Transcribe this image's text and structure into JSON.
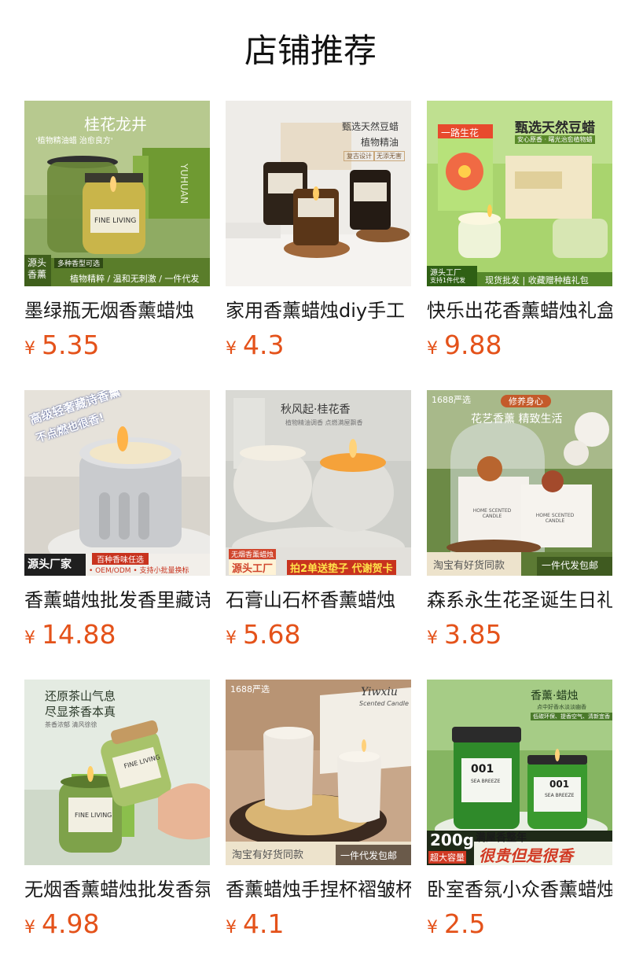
{
  "section_title": "店铺推荐",
  "currency_symbol": "¥",
  "products": [
    {
      "name": "墨绿瓶无烟香薰蜡烛",
      "price": "5.35",
      "overlay": {
        "headline": "桂花龙井",
        "sub": "'植物精油蜡 治愈良方'",
        "label": "FINE LIVING",
        "box_text": "YUHUAN",
        "badge": "源头香薰",
        "tag": "多种香型可选",
        "bar": "植物精粹 / 温和无刺激 / 一件代发"
      },
      "colors": {
        "bg": "#9bb56a",
        "jar": "#5f7f32"
      }
    },
    {
      "name": "家用香薰蜡烛diy手工",
      "price": "4.3",
      "overlay": {
        "headline": "甄选天然豆蜡",
        "sub": "植物精油",
        "tag1": "复古设计",
        "tag2": "无添无害"
      },
      "colors": {
        "bg": "#ece9e6",
        "jar": "#3b2a1e"
      }
    },
    {
      "name": "快乐出花香薰蜡烛礼盒",
      "price": "9.88",
      "overlay": {
        "headline": "甄选天然豆蜡",
        "sub": "安心原香 · 曙光治愈植物蜡",
        "box_text": "一路生花",
        "badge": "源头工厂",
        "badge_sub": "支持1件代发",
        "bar": "现货批发 | 收藏赠种植礼包"
      },
      "colors": {
        "bg": "#a7d36c",
        "jar": "#e6f2c9"
      }
    },
    {
      "name": "香薰蜡烛批发香里藏诗",
      "price": "14.88",
      "overlay": {
        "headline": "高级轻奢藏诗香薰",
        "sub": "不点燃也很香!",
        "badge": "源头厂家",
        "tag": "百种香味任选",
        "bar": "• OEM/ODM • 支持小批量换标"
      },
      "colors": {
        "bg": "#dcd8d2",
        "jar": "#c7c9cc"
      }
    },
    {
      "name": "石膏山石杯香薰蜡烛",
      "price": "5.68",
      "overlay": {
        "headline": "秋风起·桂花香",
        "sub": "植物精油调香 点燃满屋飘香",
        "tag": "无烟香薰蜡烛",
        "badge": "源头工厂",
        "bar": "拍2单送垫子 代谢贺卡"
      },
      "colors": {
        "bg": "#cfd0cb",
        "jar": "#e3e2dd"
      }
    },
    {
      "name": "森系永生花圣诞生日礼物",
      "price": "3.85",
      "overlay": {
        "corner": "1688严选",
        "ribbon": "修养身心",
        "headline": "花艺香薰 精致生活",
        "jar_label1": "HOME SCENTED CANDLE",
        "jar_label2": "HOME SCENTED CANDLE",
        "left": "淘宝有好货同款",
        "right": "一件代发包邮"
      },
      "colors": {
        "bg": "#5f7a3e",
        "jar": "#f4f1ec"
      }
    },
    {
      "name": "无烟香薰蜡烛批发香氛",
      "price": "4.98",
      "overlay": {
        "headline1": "还原茶山气息",
        "headline2": "尽显茶香本真",
        "sub": "茶香浓郁  清风徐徐",
        "label1": "FINE LIVING",
        "label2": "FINE LIVING"
      },
      "colors": {
        "bg": "#dfe6dc",
        "jar": "#7ea24a"
      }
    },
    {
      "name": "香薰蜡烛手捏杯褶皱杯",
      "price": "4.1",
      "overlay": {
        "corner": "1688严选",
        "brand": "Yiwxiu",
        "brand_sub": "Scented Candle",
        "left": "淘宝有好货同款",
        "right": "一件代发包邮"
      },
      "colors": {
        "bg": "#c9a88a",
        "jar": "#eeeae4"
      }
    },
    {
      "name": "卧室香氛小众香薰蜡烛",
      "price": "2.5",
      "overlay": {
        "headline": "香薰·蜡烛",
        "sub": "点中好香水淡淡幽香",
        "tag": "低碳环保、提香空气、清新宜香",
        "jar_num1": "001",
        "jar_num2": "001",
        "jar_text1": "SEA BREEZE",
        "jar_text2": "SEA BREEZE",
        "badge_num": "200g",
        "badge_sub": "超大容量",
        "ribbon": "满屋香整年",
        "bar": "很贵但是很香"
      },
      "colors": {
        "bg": "#7fae5a",
        "jar": "#2f8a2a"
      }
    }
  ]
}
